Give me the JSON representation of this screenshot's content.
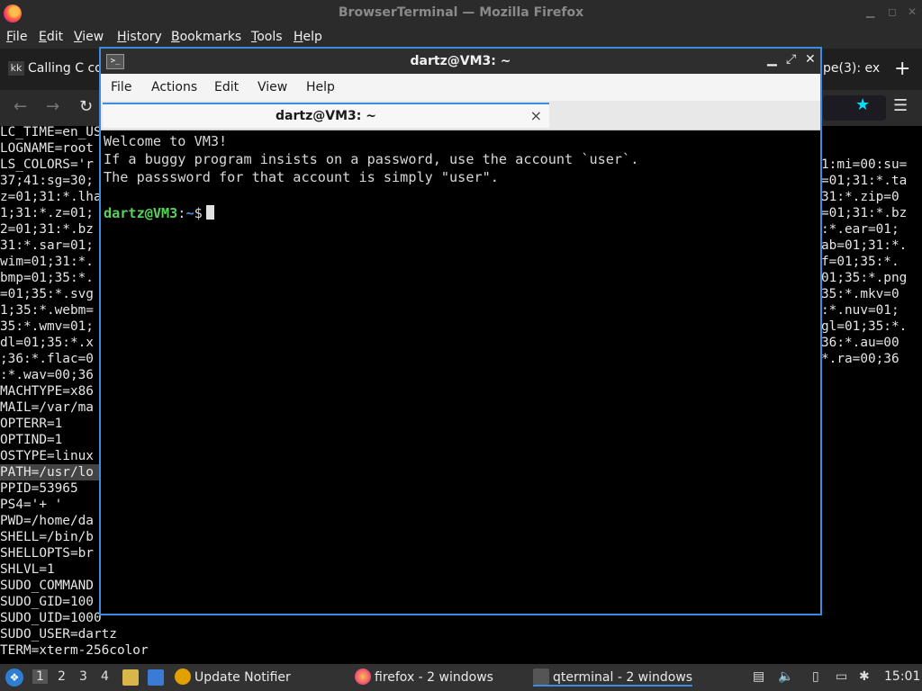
{
  "firefox": {
    "title": "BrowserTerminal — Mozilla Firefox",
    "menu": [
      "File",
      "Edit",
      "View",
      "History",
      "Bookmarks",
      "Tools",
      "Help"
    ],
    "tabs": [
      {
        "favicon": "kk",
        "label": "Calling C co"
      },
      {
        "label": "pe(3): ex"
      }
    ],
    "new_tab": "+",
    "nav": {
      "back": "←",
      "forward": "→",
      "reload": "↻",
      "bookmark_star": "★",
      "menu": "☰"
    }
  },
  "background_env": {
    "left_lines": [
      "LC_TIME=en_US",
      "LOGNAME=root",
      "LS_COLORS='r",
      "37;41:sg=30;",
      "z=01;31:*.lha",
      "1;31:*.z=01;",
      "2=01;31:*.bz",
      "31:*.sar=01;",
      "wim=01;31:*.",
      "bmp=01;35:*.",
      "=01;35:*.svg",
      "1;35:*.webm=",
      "35:*.wmv=01;",
      "dl=01;35:*.x",
      ";36:*.flac=0",
      ":*.wav=00;36",
      "MACHTYPE=x86",
      "MAIL=/var/ma",
      "OPTERR=1",
      "OPTIND=1",
      "OSTYPE=linux",
      "PATH=/usr/lo",
      "PPID=53965",
      "PS4='+ '",
      "PWD=/home/da",
      "SHELL=/bin/b",
      "SHELLOPTS=br",
      "SHLVL=1",
      "SUDO_COMMAND",
      "SUDO_GID=100"
    ],
    "right_lines": [
      "1:mi=00:su=",
      "=01;31:*.ta",
      "31:*.zip=0",
      "=01;31:*.bz",
      ":*.ear=01;",
      "ab=01;31:*.",
      "f=01;35:*.",
      "01;35:*.png",
      "35:*.mkv=0",
      ":*.nuv=01;",
      "gl=01;35:*.",
      "36:*.au=00",
      "*.ra=00;36"
    ],
    "bottom_lines": [
      "SUDO_UID=1000",
      "SUDO_USER=dartz",
      "TERM=xterm-256color"
    ]
  },
  "qterminal": {
    "title": "dartz@VM3: ~",
    "menu": [
      "File",
      "Actions",
      "Edit",
      "View",
      "Help"
    ],
    "tab_label": "dartz@VM3: ~",
    "tab_close": "×",
    "output": [
      "Welcome to VM3!",
      "If a buggy program insists on a password, use the account `user`.",
      "The passsword for that account is simply \"user\"."
    ],
    "prompt_user": "dartz@VM3",
    "prompt_colon": ":",
    "prompt_path": "~",
    "prompt_symbol": "$"
  },
  "taskbar": {
    "workspaces": [
      "1",
      "2",
      "3",
      "4"
    ],
    "active_workspace": "1",
    "tasks": [
      {
        "icon": "update-notifier-icon",
        "label": "Update Notifier"
      },
      {
        "icon": "firefox-icon",
        "label": "firefox - 2 windows"
      },
      {
        "icon": "terminal-icon",
        "label": "qterminal - 2 windows"
      }
    ],
    "clock": "15:01",
    "colors": {
      "accent": "#3a8de0",
      "prompt_user": "#55d35a",
      "prompt_path": "#4a90e2"
    }
  }
}
